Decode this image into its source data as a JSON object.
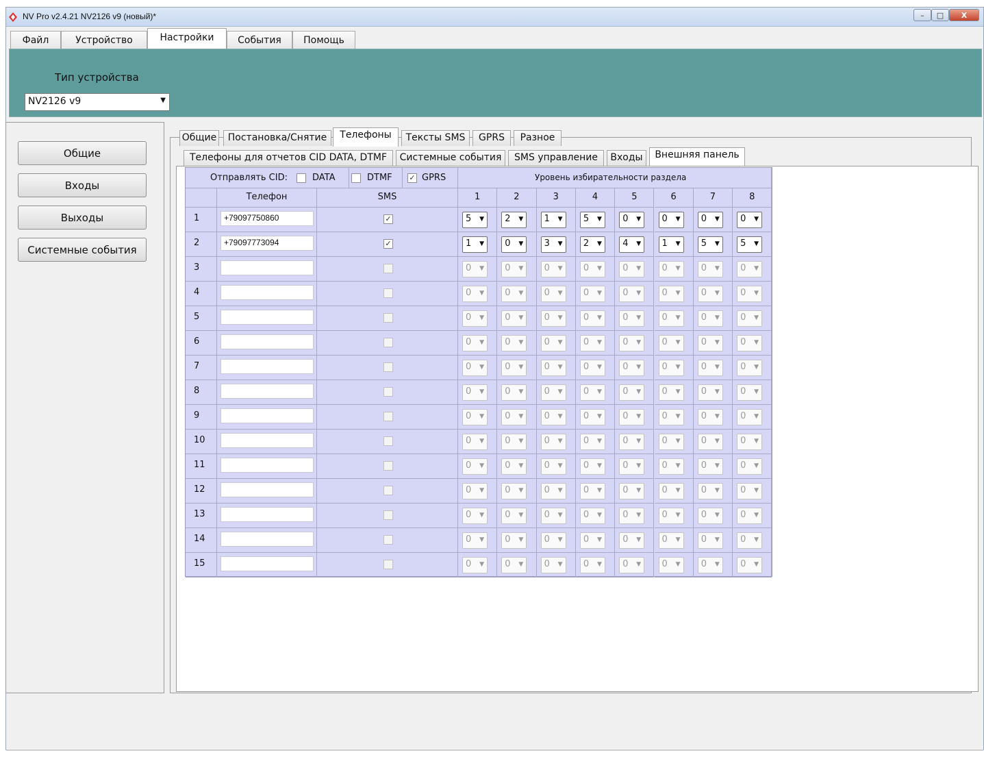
{
  "window": {
    "title": "NV Pro v2.4.21 NV2126 v9 (новый)*",
    "controls": {
      "minimize": "–",
      "maximize": "□",
      "close": "X"
    }
  },
  "menu": [
    {
      "label": "Файл"
    },
    {
      "label": "Устройство"
    },
    {
      "label": "Настройки",
      "active": true
    },
    {
      "label": "События"
    },
    {
      "label": "Помощь"
    }
  ],
  "device": {
    "label": "Тип устройства",
    "selected": "NV2126 v9"
  },
  "sidebar": [
    {
      "label": "Общие"
    },
    {
      "label": "Входы"
    },
    {
      "label": "Выходы"
    },
    {
      "label": "Системные события"
    }
  ],
  "tabs_top": [
    {
      "label": "Общие"
    },
    {
      "label": "Постановка/Снятие"
    },
    {
      "label": "Телефоны",
      "active": true
    },
    {
      "label": "Тексты SMS"
    },
    {
      "label": "GPRS"
    },
    {
      "label": "Разное"
    }
  ],
  "tabs_sub": [
    {
      "label": "Телефоны для отчетов CID DATA, DTMF"
    },
    {
      "label": "Системные события"
    },
    {
      "label": "SMS управление"
    },
    {
      "label": "Входы"
    },
    {
      "label": "Внешняя панель",
      "active": true
    }
  ],
  "grid": {
    "send_cid_label": "Отправлять CID:",
    "cid_options": [
      {
        "label": "DATA",
        "checked": false
      },
      {
        "label": "DTMF",
        "checked": false
      },
      {
        "label": "GPRS",
        "checked": true
      }
    ],
    "level_header": "Уровень избирательности раздела",
    "col_phone": "Телефон",
    "col_sms": "SMS",
    "level_cols": [
      "1",
      "2",
      "3",
      "4",
      "5",
      "6",
      "7",
      "8"
    ],
    "rows": [
      {
        "n": "1",
        "phone": "+79097750860",
        "sms": true,
        "enabled": true,
        "levels": [
          "5",
          "2",
          "1",
          "5",
          "0",
          "0",
          "0",
          "0"
        ]
      },
      {
        "n": "2",
        "phone": "+79097773094",
        "sms": true,
        "enabled": true,
        "levels": [
          "1",
          "0",
          "3",
          "2",
          "4",
          "1",
          "5",
          "5"
        ]
      },
      {
        "n": "3",
        "phone": "",
        "sms": false,
        "enabled": false,
        "levels": [
          "0",
          "0",
          "0",
          "0",
          "0",
          "0",
          "0",
          "0"
        ]
      },
      {
        "n": "4",
        "phone": "",
        "sms": false,
        "enabled": false,
        "levels": [
          "0",
          "0",
          "0",
          "0",
          "0",
          "0",
          "0",
          "0"
        ]
      },
      {
        "n": "5",
        "phone": "",
        "sms": false,
        "enabled": false,
        "levels": [
          "0",
          "0",
          "0",
          "0",
          "0",
          "0",
          "0",
          "0"
        ]
      },
      {
        "n": "6",
        "phone": "",
        "sms": false,
        "enabled": false,
        "levels": [
          "0",
          "0",
          "0",
          "0",
          "0",
          "0",
          "0",
          "0"
        ]
      },
      {
        "n": "7",
        "phone": "",
        "sms": false,
        "enabled": false,
        "levels": [
          "0",
          "0",
          "0",
          "0",
          "0",
          "0",
          "0",
          "0"
        ]
      },
      {
        "n": "8",
        "phone": "",
        "sms": false,
        "enabled": false,
        "levels": [
          "0",
          "0",
          "0",
          "0",
          "0",
          "0",
          "0",
          "0"
        ]
      },
      {
        "n": "9",
        "phone": "",
        "sms": false,
        "enabled": false,
        "levels": [
          "0",
          "0",
          "0",
          "0",
          "0",
          "0",
          "0",
          "0"
        ]
      },
      {
        "n": "10",
        "phone": "",
        "sms": false,
        "enabled": false,
        "levels": [
          "0",
          "0",
          "0",
          "0",
          "0",
          "0",
          "0",
          "0"
        ]
      },
      {
        "n": "11",
        "phone": "",
        "sms": false,
        "enabled": false,
        "levels": [
          "0",
          "0",
          "0",
          "0",
          "0",
          "0",
          "0",
          "0"
        ]
      },
      {
        "n": "12",
        "phone": "",
        "sms": false,
        "enabled": false,
        "levels": [
          "0",
          "0",
          "0",
          "0",
          "0",
          "0",
          "0",
          "0"
        ]
      },
      {
        "n": "13",
        "phone": "",
        "sms": false,
        "enabled": false,
        "levels": [
          "0",
          "0",
          "0",
          "0",
          "0",
          "0",
          "0",
          "0"
        ]
      },
      {
        "n": "14",
        "phone": "",
        "sms": false,
        "enabled": false,
        "levels": [
          "0",
          "0",
          "0",
          "0",
          "0",
          "0",
          "0",
          "0"
        ]
      },
      {
        "n": "15",
        "phone": "",
        "sms": false,
        "enabled": false,
        "levels": [
          "0",
          "0",
          "0",
          "0",
          "0",
          "0",
          "0",
          "0"
        ]
      }
    ]
  },
  "colors": {
    "header_panel": "#5f9d9d",
    "grid_bg": "#d6d6f6"
  }
}
